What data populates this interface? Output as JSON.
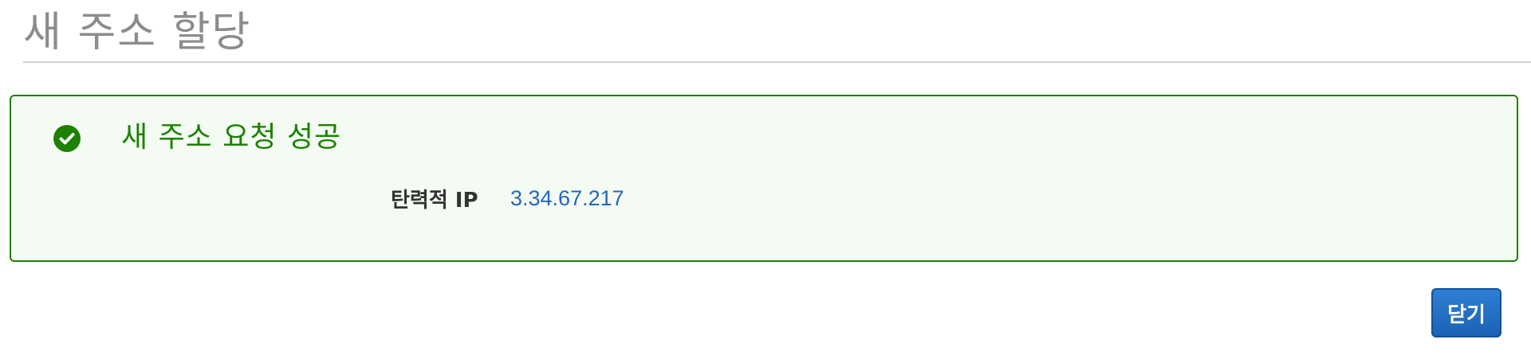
{
  "page": {
    "title": "새 주소 할당"
  },
  "success": {
    "title": "새 주소 요청 성공",
    "icon": "check-circle-icon",
    "color": "#1d8102",
    "background": "#f3fbf3"
  },
  "details": [
    {
      "label": "탄력적 IP",
      "value": "3.34.67.217"
    }
  ],
  "actions": {
    "close_label": "닫기",
    "button_color": "#1a62b6"
  }
}
